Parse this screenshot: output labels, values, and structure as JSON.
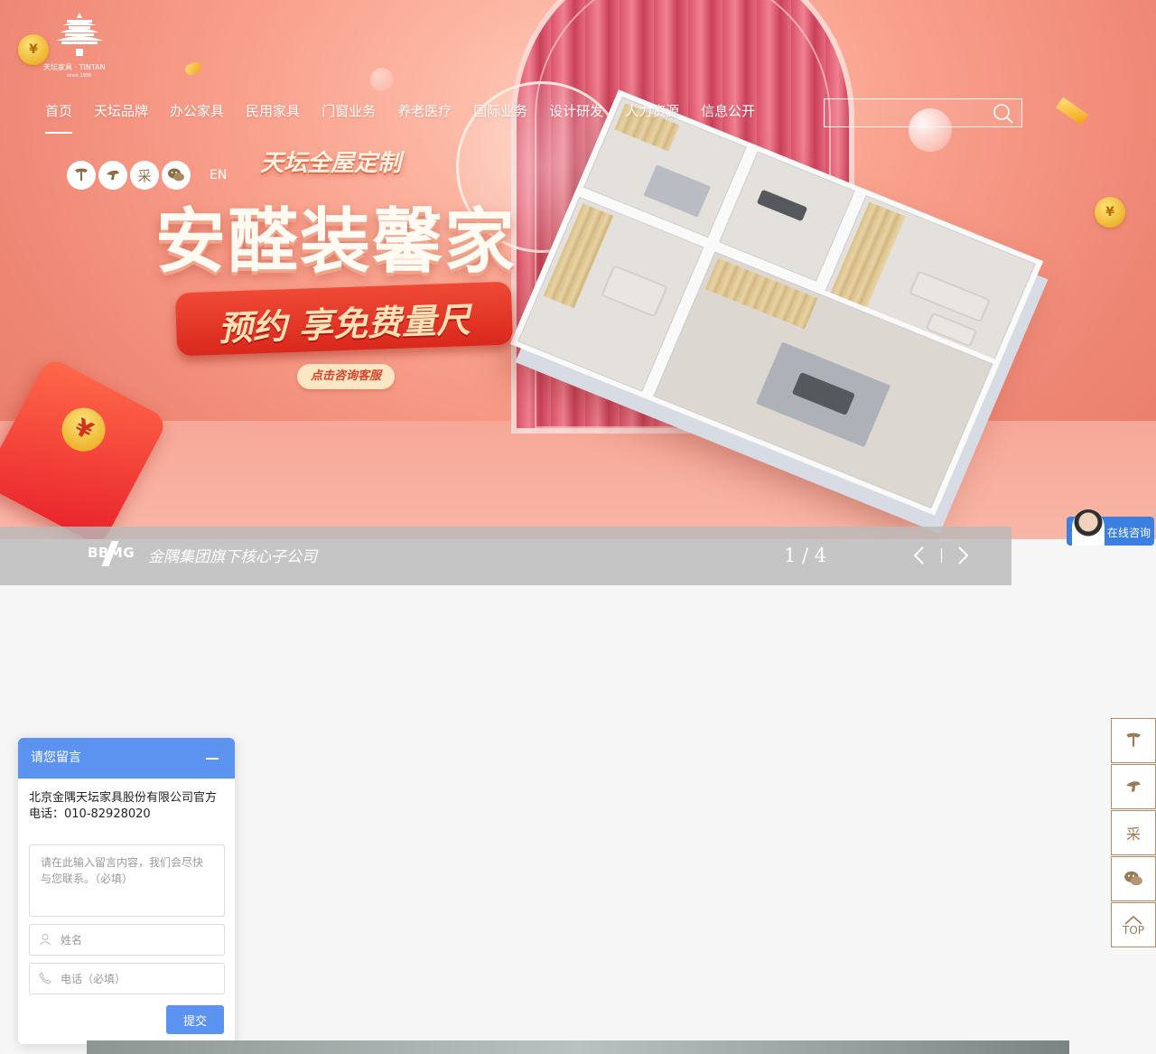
{
  "brand": {
    "logo_text": "天坛家具 · TINTAN",
    "logo_since": "since 1956"
  },
  "nav": {
    "items": [
      {
        "label": "首页",
        "active": true
      },
      {
        "label": "天坛品牌"
      },
      {
        "label": "办公家具"
      },
      {
        "label": "民用家具"
      },
      {
        "label": "门窗业务"
      },
      {
        "label": "养老医疗"
      },
      {
        "label": "国际业务"
      },
      {
        "label": "设计研发"
      },
      {
        "label": "人力资源"
      },
      {
        "label": "信息公开"
      }
    ]
  },
  "search": {
    "value": "",
    "placeholder": ""
  },
  "social": {
    "items": [
      {
        "icon": "tmall-icon"
      },
      {
        "icon": "jd-icon"
      },
      {
        "icon": "procurement-icon",
        "glyph": "采"
      },
      {
        "icon": "wechat-icon"
      }
    ],
    "lang": "EN"
  },
  "banner": {
    "small_title": "天坛全屋定制",
    "big_title": "安醛装馨家",
    "ribbon_text": "预约 享免费量尺",
    "cta": "点击咨询客服",
    "redpack_symbol": "¥"
  },
  "slider": {
    "group_logo": "BBMG",
    "subtitle": "金隅集团旗下核心子公司",
    "page_text": "1 / 4"
  },
  "consult": {
    "label": "在线咨询"
  },
  "side_tools": {
    "procurement_glyph": "采",
    "top_label": "TOP"
  },
  "message": {
    "title": "请您留言",
    "info": "北京金隅天坛家具股份有限公司官方电话：010-82928020",
    "content_placeholder": "请在此输入留言内容，我们会尽快与您联系。（必填）",
    "name_placeholder": "姓名",
    "phone_placeholder": "电话（必填）",
    "submit": "提交"
  },
  "colors": {
    "accent_blue": "#5d93f0",
    "sidebar_border": "#b08c68"
  }
}
